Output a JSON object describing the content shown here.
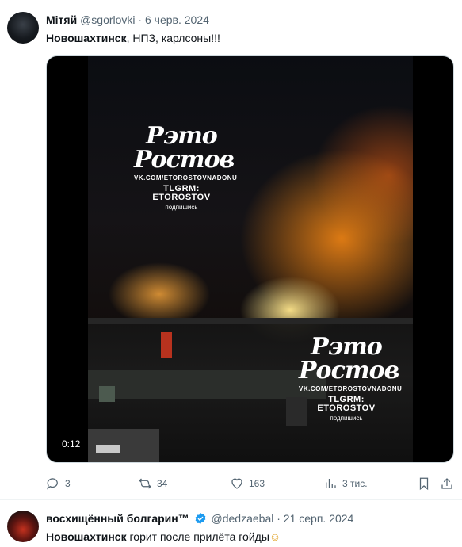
{
  "post1": {
    "display_name": "Мітяй",
    "handle": "@sgorlovki",
    "separator": "·",
    "date": "6 черв. 2024",
    "text_bold": "Новошахтинск",
    "text_rest": ", НПЗ, карлсоны!!!",
    "media": {
      "duration": "0:12",
      "watermark_logo": "Рэто Ростов",
      "watermark_url": "VK.COM/ETOROSTOVNADONU",
      "watermark_telegram": "TLGRM: ETOROSTOV",
      "watermark_sub": "подпишись"
    },
    "actions": {
      "replies": "3",
      "reposts": "34",
      "likes": "163",
      "views": "3 тис."
    }
  },
  "post2": {
    "display_name": "восхищённый болгарин™",
    "handle": "@dedzaebal",
    "separator": "·",
    "date": "21 серп. 2024",
    "text_bold": "Новошахтинск",
    "text_rest": " горит после прилёта гойды",
    "emoji": "☺"
  },
  "icons": {
    "reply": "reply-icon",
    "repost": "repost-icon",
    "like": "heart-icon",
    "views": "views-icon",
    "bookmark": "bookmark-icon",
    "share": "share-icon",
    "verified": "verified-badge-icon"
  },
  "colors": {
    "muted": "#536471",
    "verified": "#1d9bf0",
    "divider": "#eff3f4"
  }
}
